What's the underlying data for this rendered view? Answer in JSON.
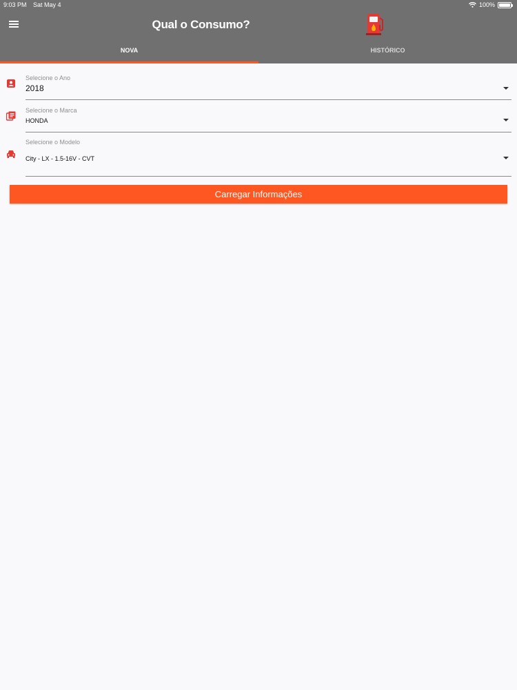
{
  "status_bar": {
    "time": "9:03 PM",
    "date": "Sat May 4",
    "battery": "100%",
    "wifi_icon": "wifi-icon",
    "battery_icon": "battery-icon"
  },
  "header": {
    "title": "Qual o Consumo?",
    "menu_icon": "hamburger-menu-icon",
    "logo_icon": "fuel-pump-icon",
    "background": "#707070"
  },
  "tabs": [
    {
      "label": "NOVA",
      "active": true
    },
    {
      "label": "HISTÓRICO",
      "active": false
    }
  ],
  "accent_color": "#ff5722",
  "form": {
    "year": {
      "label": "Selecione o Ano",
      "value": "2018",
      "icon": "calendar-icon"
    },
    "brand": {
      "label": "Selecione o Marca",
      "value": "HONDA",
      "icon": "list-icon"
    },
    "model": {
      "label": "Selecione o Modelo",
      "value": "City - LX - 1.5-16V - CVT",
      "icon": "car-icon"
    }
  },
  "load_button": {
    "label": "Carregar Informações"
  }
}
